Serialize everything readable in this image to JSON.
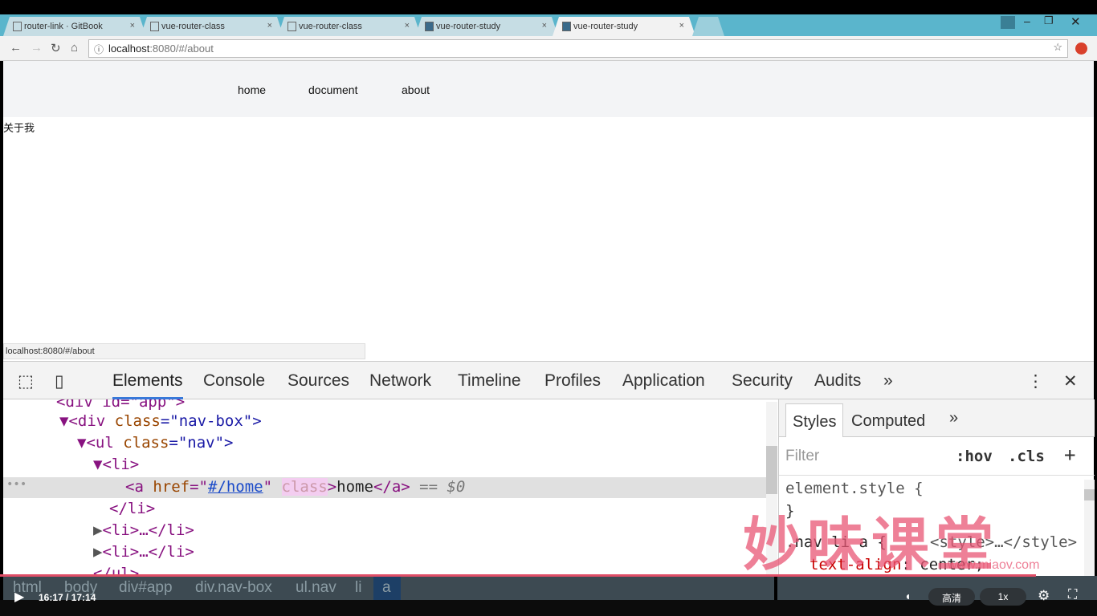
{
  "tabs": [
    {
      "title": "router-link · GitBook"
    },
    {
      "title": "vue-router-class"
    },
    {
      "title": "vue-router-class"
    },
    {
      "title": "vue-router-study"
    },
    {
      "title": "vue-router-study",
      "active": true
    }
  ],
  "address": {
    "host": "localhost",
    "rest": ":8080/#/about"
  },
  "page": {
    "nav": [
      "home",
      "document",
      "about"
    ],
    "content": "关于我",
    "status_url": "localhost:8080/#/about"
  },
  "devtools": {
    "tabs": [
      "Elements",
      "Console",
      "Sources",
      "Network",
      "Timeline",
      "Profiles",
      "Application",
      "Security",
      "Audits"
    ],
    "tree": {
      "l0": "<div id=\"app\">",
      "l1a": "<div ",
      "l1b": "class",
      "l1c": "=\"nav-box\">",
      "l2a": "<ul ",
      "l2b": "class",
      "l2c": "=\"nav\">",
      "l3": "<li>",
      "l4a": "<a ",
      "l4b": "href",
      "l4c": "#/home",
      "l4d": "class",
      "l4e": "home",
      "l4f": "</a>",
      "l4g": "== $0",
      "l5": "</li>",
      "l6": "<li>…</li>",
      "l7": "<li>…</li>",
      "l8": "</ul>"
    },
    "breadcrumb": [
      "html",
      "body",
      "div#app",
      "div.nav-box",
      "ul.nav",
      "li",
      "a"
    ],
    "styles": {
      "tabs": [
        "Styles",
        "Computed"
      ],
      "filter_placeholder": "Filter",
      "hov": ":hov",
      "cls": ".cls",
      "rule1": "element.style {",
      "close": "}",
      "rule2": ".nav li a {",
      "source": "<style>…</style>",
      "prop": "text-align",
      "value": "center;"
    }
  },
  "video": {
    "time": "16:17 / 17:14",
    "quality": "高清",
    "speed": "1x",
    "progress": 0.944,
    "accent": "#e04e67"
  },
  "watermark": {
    "text": "妙味课堂",
    "url": "www.miaov.com"
  }
}
